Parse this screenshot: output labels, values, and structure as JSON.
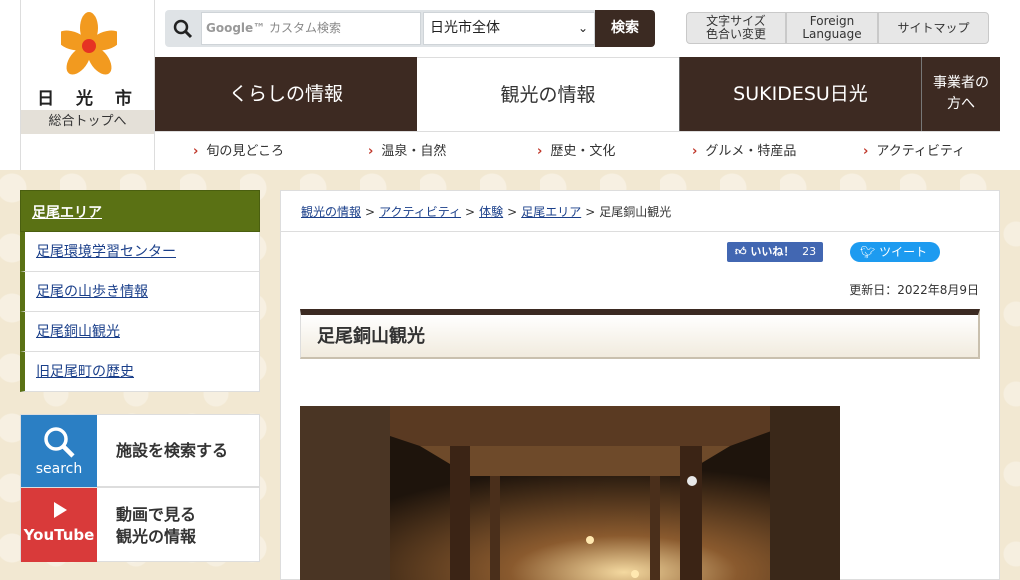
{
  "header": {
    "city_name": "日 光 市",
    "top_link": "総合トップへ",
    "search": {
      "placeholder_brand": "Google™",
      "placeholder": "カスタム検索",
      "scope_selected": "日光市全体",
      "button_label": "検索"
    },
    "utility": {
      "font_size_line1": "文字サイズ",
      "font_size_line2": "色合い変更",
      "foreign_line1": "Foreign",
      "foreign_line2": "Language",
      "sitemap": "サイトマップ"
    }
  },
  "nav": {
    "items": [
      {
        "label": "くらしの情報"
      },
      {
        "label": "観光の情報"
      },
      {
        "label": "SUKIDESU日光"
      },
      {
        "label_line1": "事業者の",
        "label_line2": "方へ"
      }
    ]
  },
  "subnav": {
    "items": [
      "旬の見どころ",
      "温泉・自然",
      "歴史・文化",
      "グルメ・特産品",
      "アクティビティ"
    ]
  },
  "sidebar": {
    "heading": "足尾エリア",
    "items": [
      "足尾環境学習センター",
      "足尾の山歩き情報",
      "足尾銅山観光",
      "旧足尾町の歴史"
    ]
  },
  "banners": [
    {
      "icon_text": "search",
      "label": "施設を検索する"
    },
    {
      "icon_text": "YouTube",
      "label_line1": "動画で見る",
      "label_line2": "観光の情報"
    }
  ],
  "breadcrumb": {
    "links": [
      "観光の情報",
      "アクティビティ",
      "体験",
      "足尾エリア"
    ],
    "current": "足尾銅山観光",
    "separator": ">"
  },
  "social": {
    "like_label": "いいね！",
    "like_count": "23",
    "tweet_label": "ツイート"
  },
  "page": {
    "updated": "更新日：2022年8月9日",
    "title": "足尾銅山観光"
  },
  "colors": {
    "nav_dark": "#3d2a22",
    "sidebar_green": "#5a7114",
    "search_tile_blue": "#2b7fc4",
    "youtube_red": "#d93a3a"
  }
}
